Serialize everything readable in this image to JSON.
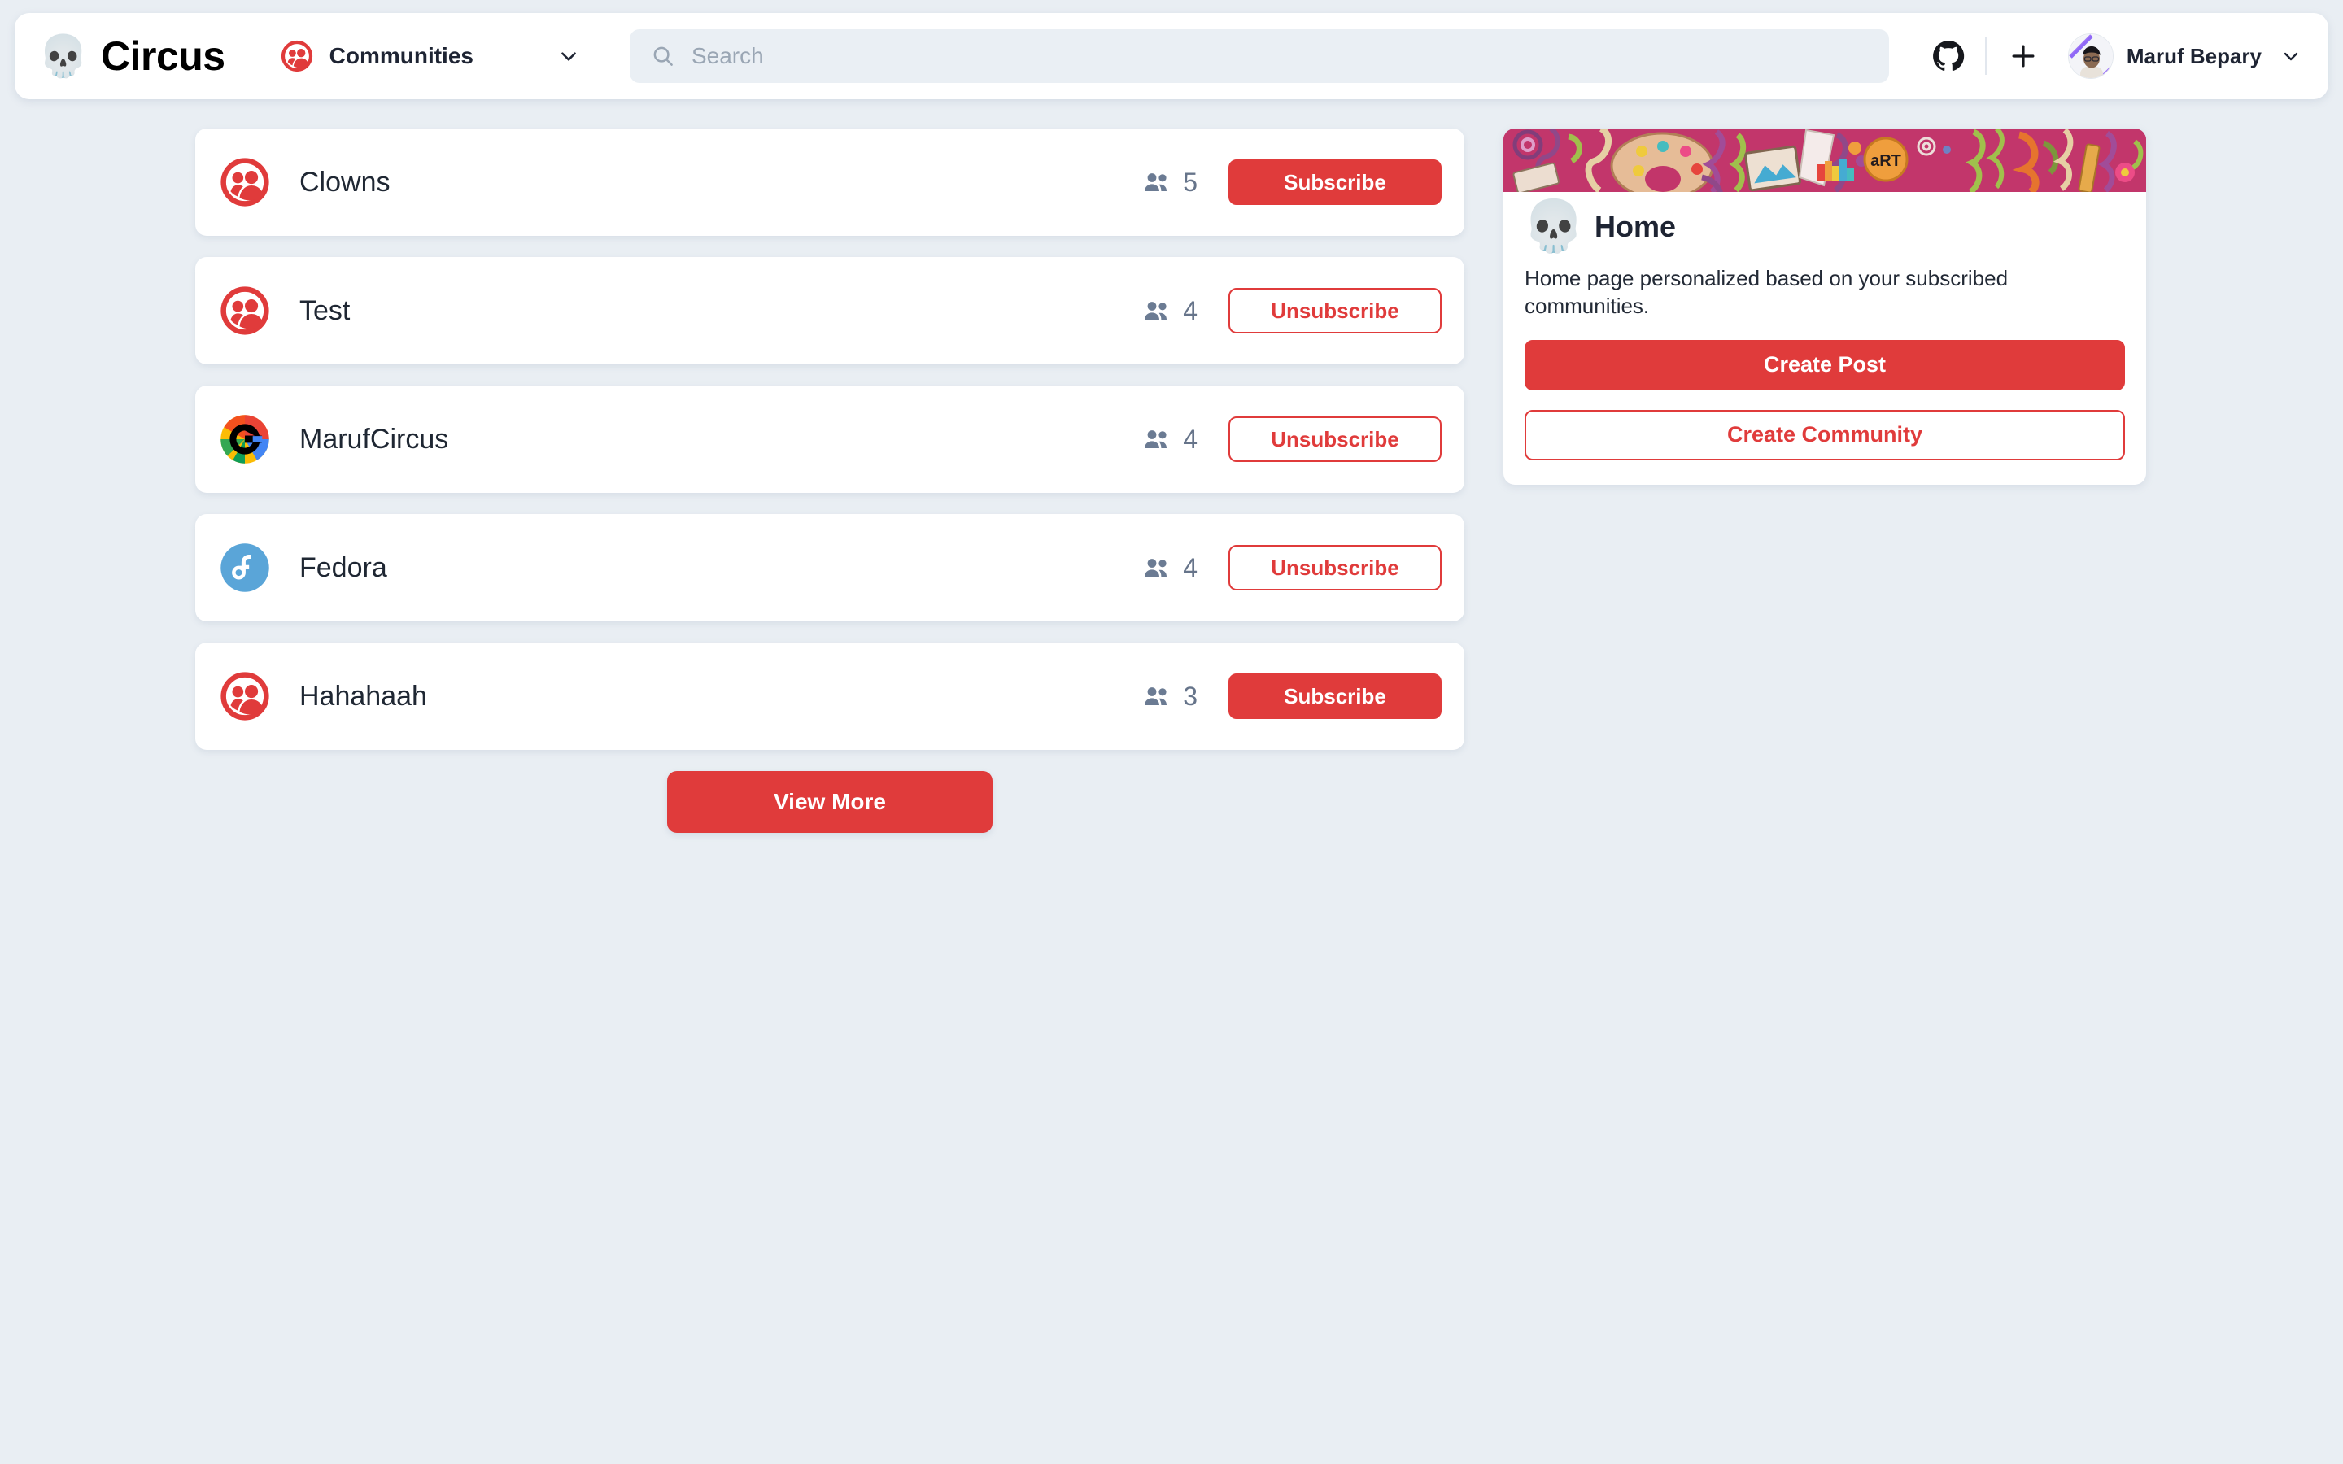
{
  "header": {
    "logo_icon": "skull-emoji-logo",
    "logo_emoji": "💀",
    "brand_name": "Circus",
    "scope": {
      "icon": "people-group-icon",
      "label": "Communities",
      "chevron_icon": "chevron-down-icon"
    },
    "search": {
      "icon": "search-icon",
      "placeholder": "Search",
      "value": ""
    },
    "actions": {
      "github_icon": "github-icon",
      "plus_icon": "plus-icon"
    },
    "user": {
      "avatar_icon": "user-avatar",
      "name": "Maruf Bepary",
      "chevron_icon": "chevron-down-icon"
    }
  },
  "main": {
    "members_icon": "people-pair-icon",
    "communities": [
      {
        "name": "Clowns",
        "avatar": "community-default-icon",
        "members": "5",
        "action_label": "Subscribe",
        "action_style": "solid"
      },
      {
        "name": "Test",
        "avatar": "community-default-icon",
        "members": "4",
        "action_label": "Unsubscribe",
        "action_style": "outline"
      },
      {
        "name": "MarufCircus",
        "avatar": "google-g-icon",
        "members": "4",
        "action_label": "Unsubscribe",
        "action_style": "outline"
      },
      {
        "name": "Fedora",
        "avatar": "fedora-icon",
        "members": "4",
        "action_label": "Unsubscribe",
        "action_style": "outline"
      },
      {
        "name": "Hahahaah",
        "avatar": "community-default-icon",
        "members": "3",
        "action_label": "Subscribe",
        "action_style": "solid"
      }
    ],
    "view_more_label": "View More"
  },
  "sidebar": {
    "banner_icon": "art-doodle-banner",
    "banner_badge_text": "aRT",
    "skull_emoji": "💀",
    "title": "Home",
    "description": "Home page personalized based on your subscribed communities.",
    "create_post_label": "Create Post",
    "create_community_label": "Create Community"
  },
  "colors": {
    "accent_red": "#e03b3b",
    "page_background": "#e9eef3",
    "card_background": "#ffffff",
    "text_dark": "#1e2433",
    "muted_text": "#66748a",
    "search_background": "#eaeff4"
  }
}
